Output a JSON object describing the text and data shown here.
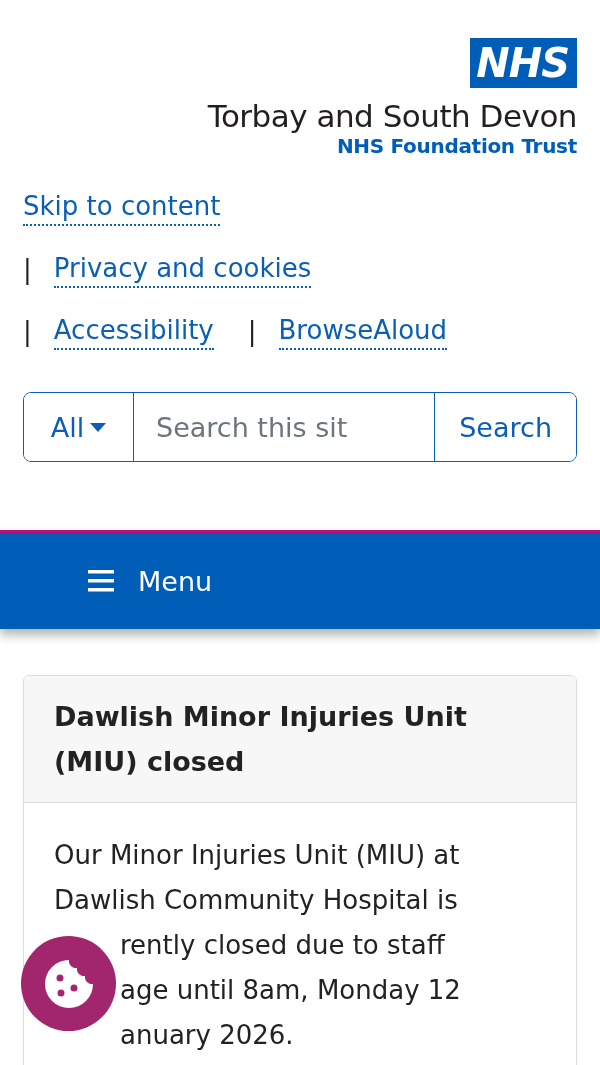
{
  "header": {
    "logo": "NHS",
    "trust_name": "Torbay and South Devon",
    "trust_subtitle": "NHS Foundation Trust"
  },
  "links": [
    {
      "label": "Skip to content"
    },
    {
      "separator": "|",
      "label": "Privacy and cookies"
    },
    {
      "separator": "|",
      "label": "Accessibility"
    },
    {
      "separator": "|",
      "label": "BrowseAloud"
    }
  ],
  "search": {
    "scope": "All",
    "placeholder": "Search this sit",
    "button": "Search"
  },
  "nav": {
    "menu": "Menu"
  },
  "alert": {
    "title": "Dawlish Minor Injuries Unit (MIU) closed",
    "body_lines": [
      {
        "kind": "full",
        "text": "Our Minor Injuries Unit (MIU) at"
      },
      {
        "kind": "full",
        "text": "Dawlish Community Hospital is"
      },
      {
        "kind": "partly-covered",
        "text": "rently closed due to staff"
      },
      {
        "kind": "partly-covered",
        "text": "age until 8am, Monday 12"
      },
      {
        "kind": "partly-covered",
        "text": "anuary 2026."
      }
    ]
  }
}
